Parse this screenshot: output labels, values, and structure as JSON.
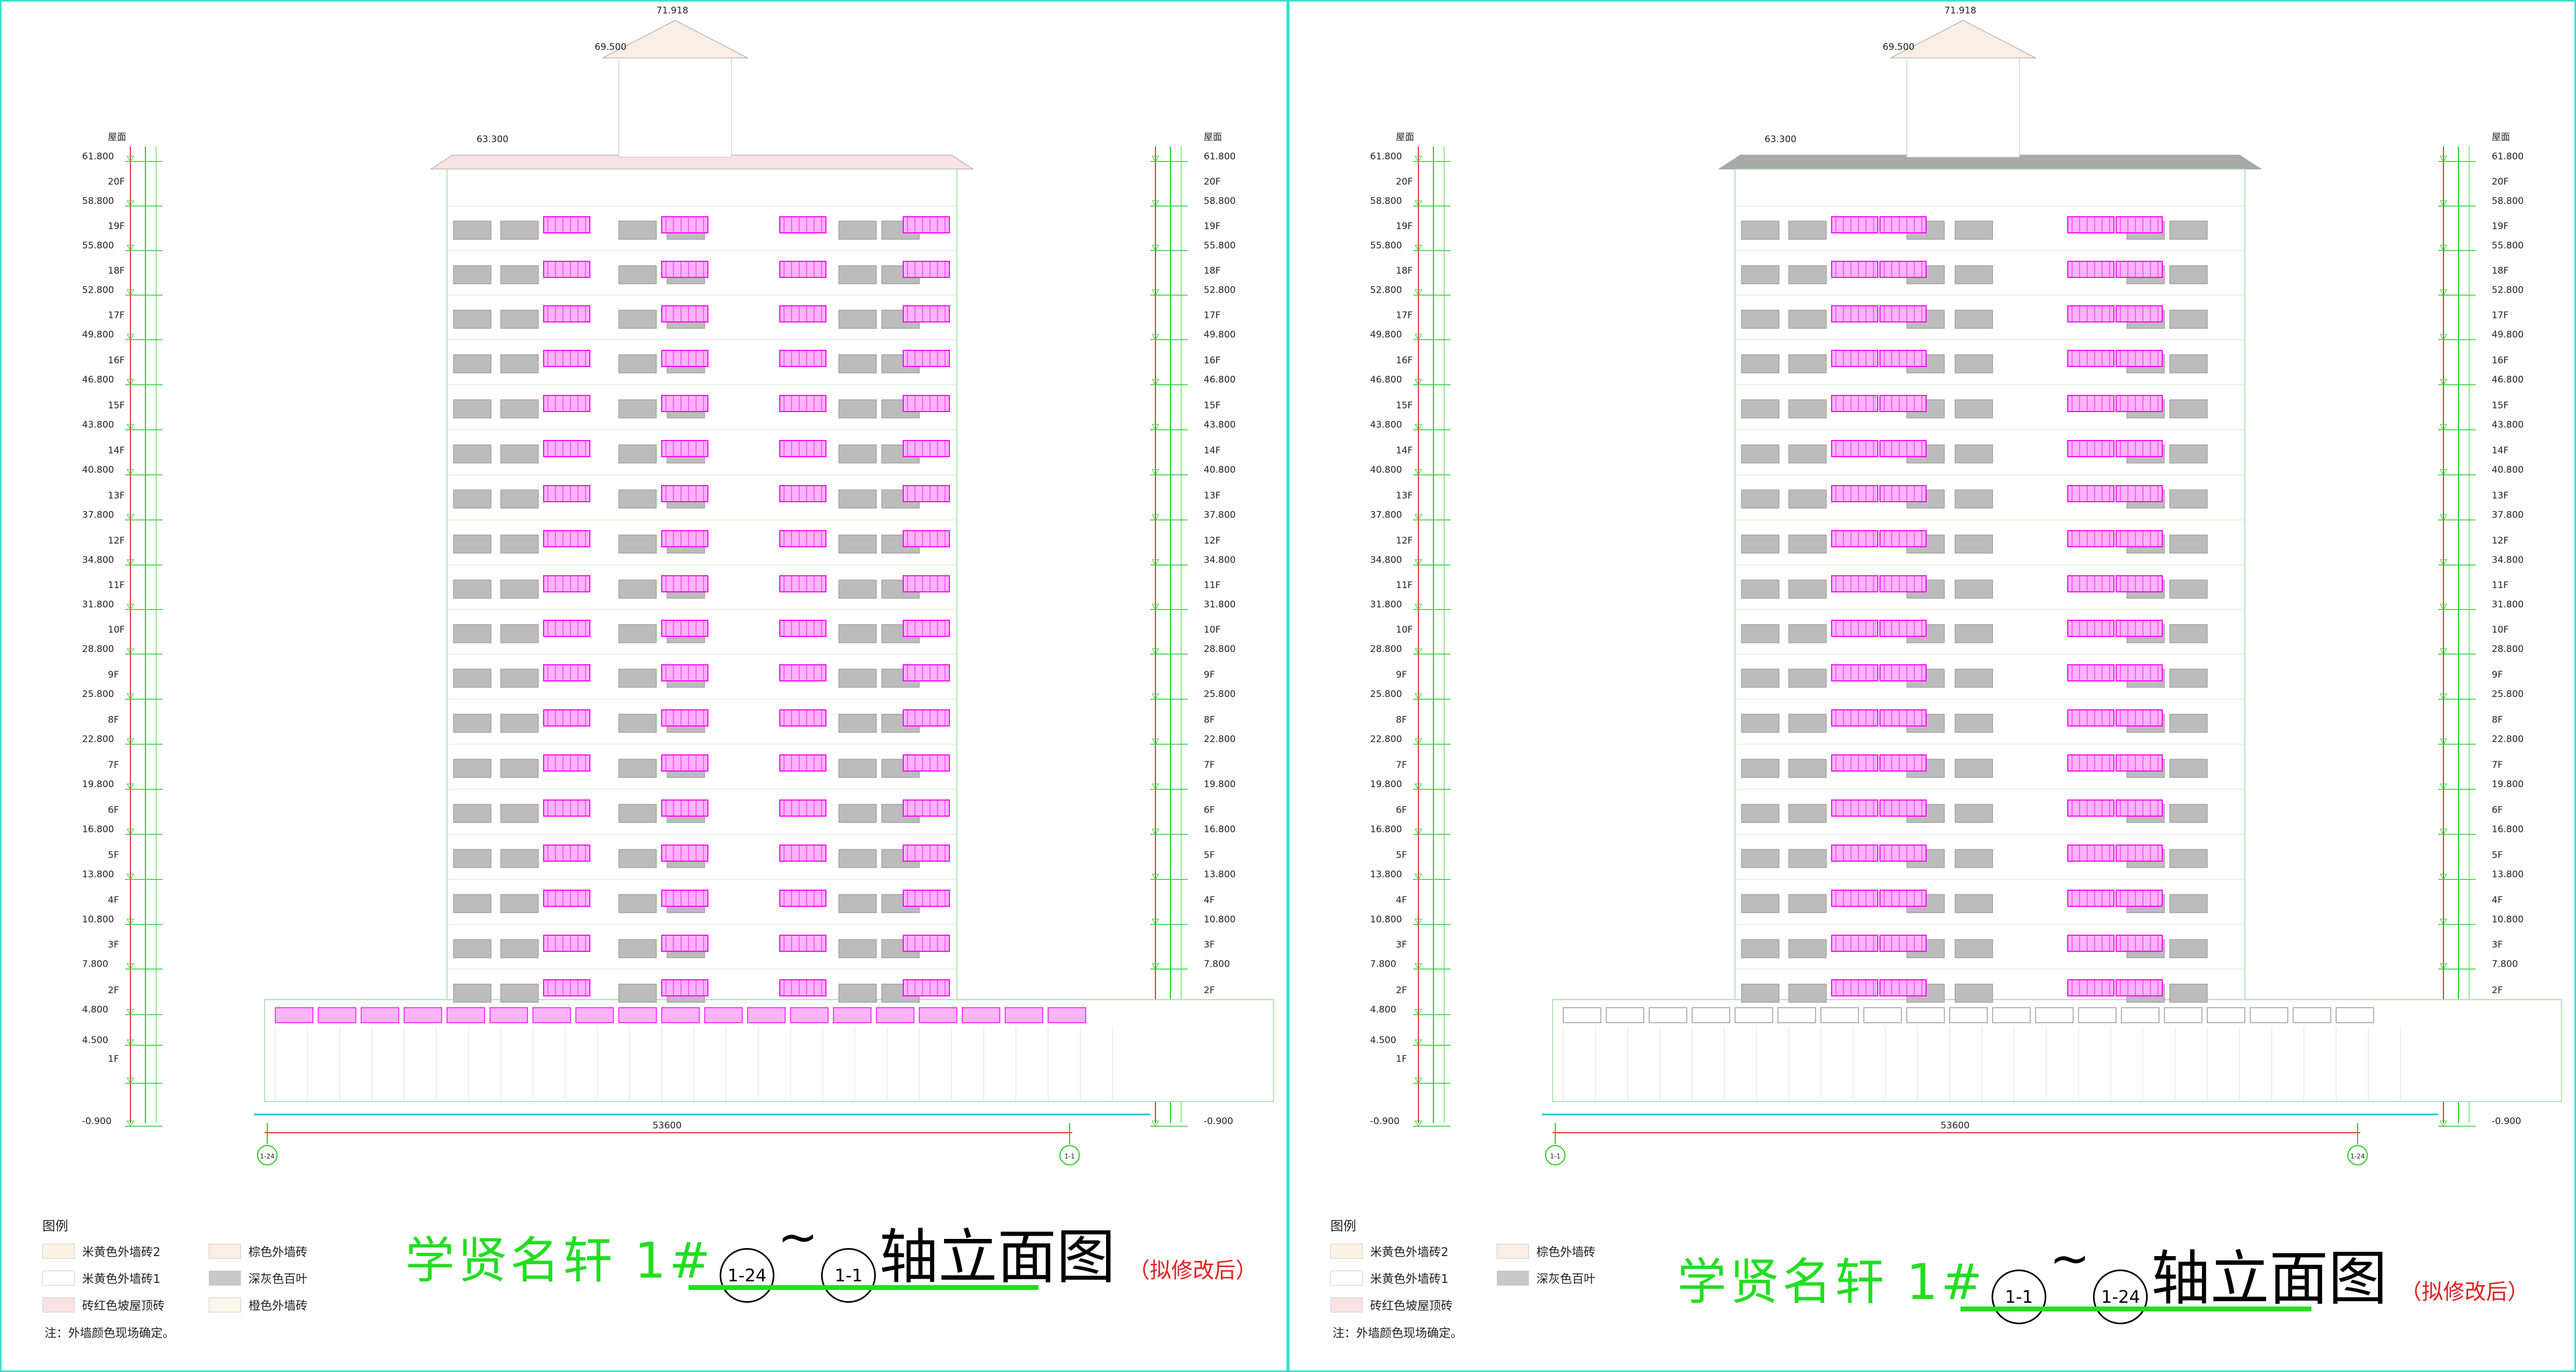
{
  "colors": {
    "frame": "#40e0d0",
    "title_green": "#22dd22",
    "magenta": "#ff00ff",
    "grey": "#bcbcbc",
    "orange": "#e8801a",
    "note_red": "#e02020"
  },
  "levels": [
    {
      "elev": "61.800",
      "floor": "屋面"
    },
    {
      "elev": "58.800",
      "floor": "20F"
    },
    {
      "elev": "55.800",
      "floor": "19F"
    },
    {
      "elev": "52.800",
      "floor": "18F"
    },
    {
      "elev": "49.800",
      "floor": "17F"
    },
    {
      "elev": "46.800",
      "floor": "16F"
    },
    {
      "elev": "43.800",
      "floor": "15F"
    },
    {
      "elev": "40.800",
      "floor": "14F"
    },
    {
      "elev": "37.800",
      "floor": "13F"
    },
    {
      "elev": "34.800",
      "floor": "12F"
    },
    {
      "elev": "31.800",
      "floor": "11F"
    },
    {
      "elev": "28.800",
      "floor": "10F"
    },
    {
      "elev": "25.800",
      "floor": "9F"
    },
    {
      "elev": "22.800",
      "floor": "8F"
    },
    {
      "elev": "19.800",
      "floor": "7F"
    },
    {
      "elev": "16.800",
      "floor": "6F"
    },
    {
      "elev": "13.800",
      "floor": "5F"
    },
    {
      "elev": "10.800",
      "floor": "4F"
    },
    {
      "elev": "7.800",
      "floor": "3F"
    },
    {
      "elev": "4.800",
      "floor": "2F"
    },
    {
      "elev": "4.500",
      "floor": ""
    },
    {
      "elev": "",
      "floor": "1F"
    },
    {
      "elev": "-0.900",
      "floor": ""
    }
  ],
  "top_marks": {
    "peak": "71.918",
    "tower": "69.500",
    "roof": "63.300"
  },
  "dim_total": "53600",
  "left": {
    "title_project": "学贤名轩  1#",
    "axis_from": "1-24",
    "axis_to": "1-1",
    "tilde": "~",
    "title_main": "轴立面图",
    "title_note": "（拟修改后）",
    "axis_left": "1-24",
    "axis_right": "1-1",
    "legend_header": "图例",
    "legend": [
      {
        "label": "米黄色外墙砖2",
        "color": "#fdf3e4"
      },
      {
        "label": "米黄色外墙砖1",
        "color": "#ffffff"
      },
      {
        "label": "砖红色坡屋顶砖",
        "color": "#fbe3e3"
      },
      {
        "label": "棕色外墙砖",
        "color": "#fbeee4"
      },
      {
        "label": "深灰色百叶",
        "color": "#c8c8c8"
      },
      {
        "label": "橙色外墙砖",
        "color": "#fdf6ea"
      }
    ],
    "footnote": "注：外墙颜色现场确定。"
  },
  "right": {
    "title_project": "学贤名轩  1#",
    "axis_from": "1-1",
    "axis_to": "1-24",
    "tilde": "~",
    "title_main": "轴立面图",
    "title_note": "（拟修改后）",
    "axis_left": "1-1",
    "axis_right": "1-24",
    "legend_header": "图例",
    "legend": [
      {
        "label": "米黄色外墙砖2",
        "color": "#fdf3e4"
      },
      {
        "label": "米黄色外墙砖1",
        "color": "#ffffff"
      },
      {
        "label": "砖红色坡屋顶砖",
        "color": "#fbe3e3"
      },
      {
        "label": "棕色外墙砖",
        "color": "#fbeee4"
      },
      {
        "label": "深灰色百叶",
        "color": "#c8c8c8"
      }
    ],
    "footnote": "注：外墙颜色现场确定。"
  }
}
